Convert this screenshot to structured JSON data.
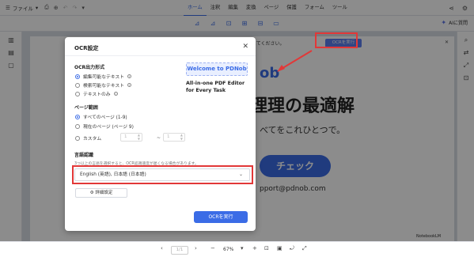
{
  "topbar": {
    "file_label": "ファイル",
    "menu": [
      {
        "label": "ホーム",
        "active": true
      },
      {
        "label": "注釈",
        "active": false
      },
      {
        "label": "編集",
        "active": false
      },
      {
        "label": "変換",
        "active": false
      },
      {
        "label": "ページ",
        "active": false
      },
      {
        "label": "保護",
        "active": false
      },
      {
        "label": "フォーム",
        "active": false
      },
      {
        "label": "ツール",
        "active": false
      }
    ]
  },
  "toolbar": {
    "ai_label": "AIに質問"
  },
  "document": {
    "notice_text": "きるようにしてください。",
    "notice_button": "OCRを実行",
    "brand_fragment": "ob",
    "big_title": "理理の最適解",
    "big_sub": "べてをこれひとつで。",
    "cta_fragment": "チェック",
    "support_fragment": "pport@pdnob.com",
    "notebook_label": "NotebookLM"
  },
  "bottombar": {
    "page_input": "1/1",
    "zoom": "67%"
  },
  "modal": {
    "title": "OCR設定",
    "output_section": "OCR出力形式",
    "output_options": [
      {
        "label": "編集可能なテキスト",
        "selected": true
      },
      {
        "label": "検索可能なテキスト",
        "selected": false
      },
      {
        "label": "テキストのみ",
        "selected": false
      }
    ],
    "promo_badge": "Welcome to PDNob",
    "promo_line1": "All-in-one PDF Editor",
    "promo_line2": "for Every Task",
    "range_section": "ページ範囲",
    "range_options": [
      {
        "label": "すべてのページ (1-9)",
        "selected": true
      },
      {
        "label": "現在のページ (ページ 9)",
        "selected": false
      },
      {
        "label": "カスタム",
        "selected": false
      }
    ],
    "custom_from": "1",
    "custom_to": "1",
    "language_section": "言語認識",
    "language_hint": "3つ以上の言語を選択すると、OCR認識速度が遅くなる場合があります。",
    "language_value": "English (英語), 日本語 (日本語)",
    "advanced_label": "詳細設定",
    "run_label": "OCRを実行"
  },
  "colors": {
    "accent": "#3b6ce6",
    "highlight": "#e23838"
  }
}
